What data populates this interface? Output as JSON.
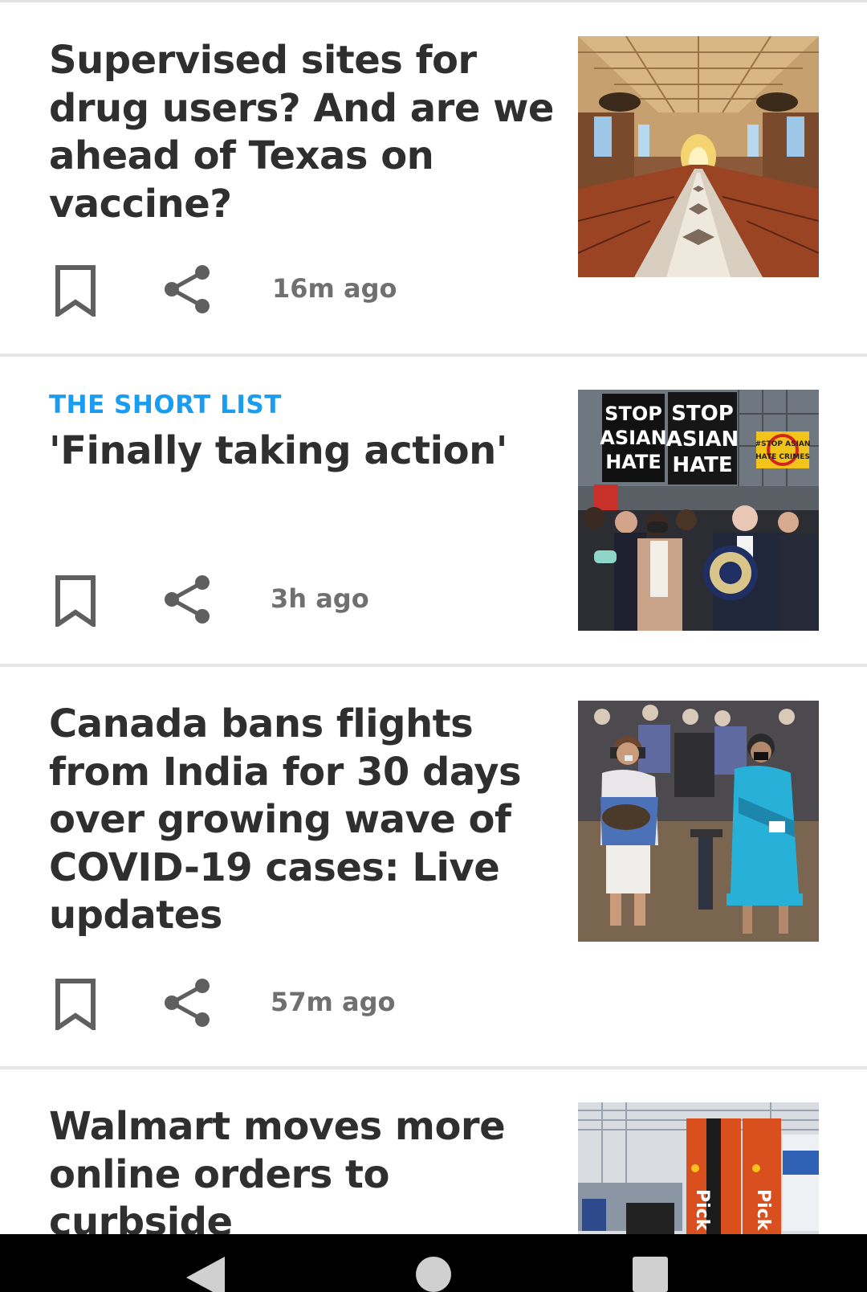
{
  "articles": [
    {
      "kicker": "",
      "headline": "Supervised sites for drug users? And are we ahead of Texas on vaccine?",
      "time": "16m ago",
      "image": "train-station-hall"
    },
    {
      "kicker": "THE SHORT LIST",
      "headline": "'Finally taking action'",
      "time": "3h ago",
      "image": "stop-asian-hate-rally",
      "signs": [
        "#STOP ASIAN HATE",
        "#STOP ASIAN HATE",
        "#STOP ASIAN HATE CRIMES"
      ]
    },
    {
      "kicker": "",
      "headline": "Canada bans flights from India for 30 days over growing wave of COVID-19 cases: Live updates",
      "time": "57m ago",
      "image": "vaccination-center-waiting"
    },
    {
      "kicker": "",
      "headline": "Walmart moves more online orders to curbside",
      "time": "",
      "image": "walmart-pickup-tower",
      "tower_label": "Pick"
    }
  ],
  "icons": {
    "bookmark": "bookmark-outline-icon",
    "share": "share-icon",
    "nav_back": "back-triangle-icon",
    "nav_home": "home-circle-icon",
    "nav_recents": "recents-square-icon"
  },
  "colors": {
    "kicker": "#1a9cf0",
    "headline": "#2f2f2f",
    "meta": "#707070",
    "icon": "#5f5f5f"
  }
}
